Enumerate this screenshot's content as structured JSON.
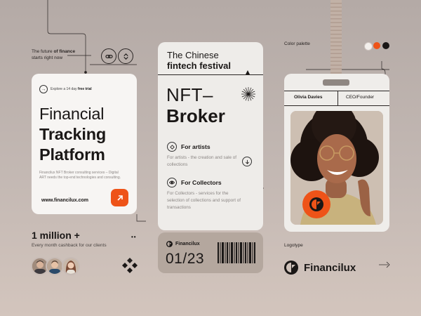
{
  "tagline": {
    "line1_prefix": "The future ",
    "line1_bold": "of finance",
    "line2": "starts right now"
  },
  "left_card": {
    "trial_prefix": "Explore a 14 day ",
    "trial_bold": "free trial",
    "title_line1": "Financial",
    "title_line2": "Tracking",
    "title_line3": "Platform",
    "description": "Financilux NFT Broker consulting services – Digital ART needs the top-end technologies and consulting.",
    "website": "www.financilux.com"
  },
  "stats": {
    "headline": "1 million +",
    "subtext": "Every month cashback for our clients",
    "dots": "••"
  },
  "mid_card": {
    "heading_line1": "The Chinese",
    "heading_line2": "fintech festival",
    "title_line1": "NFT–",
    "title_line2": "Broker",
    "sections": [
      {
        "label": "For artists",
        "description": "For artists - the creation and sale of collections"
      },
      {
        "label": "For Collectors",
        "description": "For Collectors - services for the selection of collections and support of transactions"
      }
    ]
  },
  "ticket": {
    "brand": "Financilux",
    "number": "01/23"
  },
  "badge": {
    "name": "Olivia Davies",
    "role": "CEO/Founder"
  },
  "palette": {
    "label": "Color palette",
    "colors": [
      "#f3efec",
      "#ee5318",
      "#1a1716"
    ]
  },
  "logotype": {
    "label": "Logotype",
    "brand": "Financilux"
  },
  "colors": {
    "accent": "#ee5318",
    "dark": "#1a1716",
    "card": "#f7f5f3"
  },
  "icons": [
    "chain-link-icon",
    "swap-icon",
    "arrow-right-icon",
    "arrow-up-right-icon",
    "sunburst-icon",
    "pen-nib-icon",
    "eye-icon",
    "arrow-down-icon",
    "financilux-logo-icon",
    "knot-icon"
  ]
}
